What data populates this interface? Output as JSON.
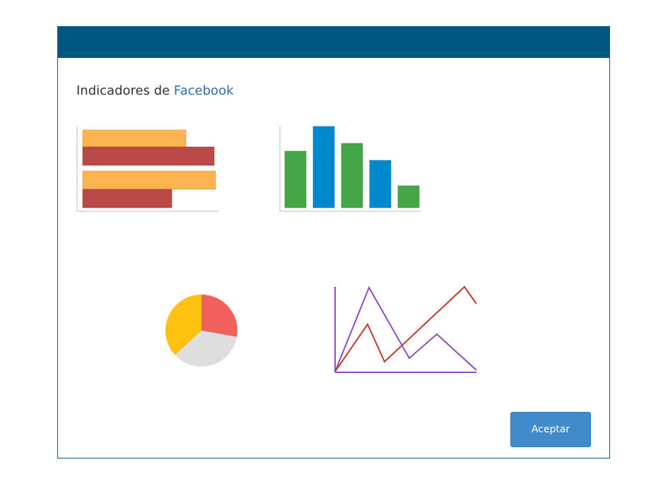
{
  "dialog": {
    "title_prefix": "Indicadores de ",
    "title_accent": "Facebook",
    "accept_label": "Aceptar"
  },
  "colors": {
    "header": "#005781",
    "border": "#0d5a7e",
    "accent_text": "#2e6db4",
    "button": "#428bca"
  },
  "illustrations": [
    "horizontal-bar-chart-icon",
    "vertical-bar-chart-icon",
    "pie-chart-icon",
    "line-chart-icon"
  ]
}
